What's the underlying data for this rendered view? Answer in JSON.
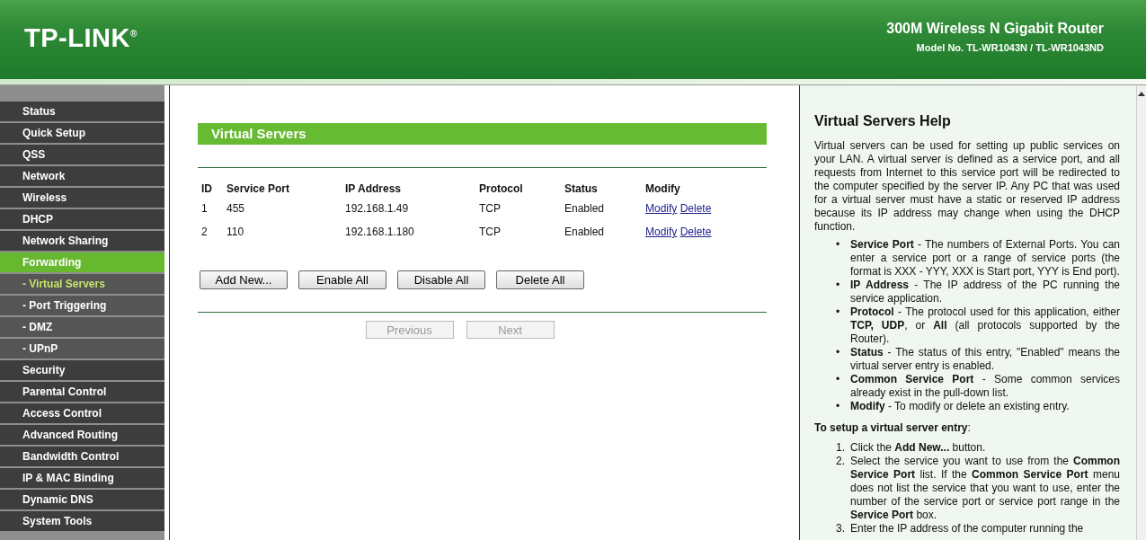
{
  "header": {
    "logo": "TP-LINK$^{®}$",
    "product": "300M Wireless N Gigabit Router",
    "model": "Model No. TL-WR1043N / TL-WR1043ND"
  },
  "sidebar": {
    "items": [
      {
        "label": "Status",
        "kind": "main",
        "selected": false
      },
      {
        "label": "Quick Setup",
        "kind": "main",
        "selected": false
      },
      {
        "label": "QSS",
        "kind": "main",
        "selected": false
      },
      {
        "label": "Network",
        "kind": "main",
        "selected": false
      },
      {
        "label": "Wireless",
        "kind": "main",
        "selected": false
      },
      {
        "label": "DHCP",
        "kind": "main",
        "selected": false
      },
      {
        "label": "Network Sharing",
        "kind": "main",
        "selected": false
      },
      {
        "label": "Forwarding",
        "kind": "main",
        "selected": true
      },
      {
        "label": "- Virtual Servers",
        "kind": "sub",
        "selected": true
      },
      {
        "label": "- Port Triggering",
        "kind": "sub",
        "selected": false
      },
      {
        "label": "- DMZ",
        "kind": "sub",
        "selected": false
      },
      {
        "label": "- UPnP",
        "kind": "sub",
        "selected": false
      },
      {
        "label": "Security",
        "kind": "main",
        "selected": false
      },
      {
        "label": "Parental Control",
        "kind": "main",
        "selected": false
      },
      {
        "label": "Access Control",
        "kind": "main",
        "selected": false
      },
      {
        "label": "Advanced Routing",
        "kind": "main",
        "selected": false
      },
      {
        "label": "Bandwidth Control",
        "kind": "main",
        "selected": false
      },
      {
        "label": "IP & MAC Binding",
        "kind": "main",
        "selected": false
      },
      {
        "label": "Dynamic DNS",
        "kind": "main",
        "selected": false
      },
      {
        "label": "System Tools",
        "kind": "main",
        "selected": false
      }
    ]
  },
  "main": {
    "title": "Virtual Servers",
    "table": {
      "columns": [
        "ID",
        "Service Port",
        "IP Address",
        "Protocol",
        "Status",
        "Modify"
      ],
      "rows": [
        {
          "id": "1",
          "service_port": "455",
          "ip_address": "192.168.1.49",
          "protocol": "TCP",
          "status": "Enabled",
          "modify": "Modify",
          "delete": "Delete"
        },
        {
          "id": "2",
          "service_port": "110",
          "ip_address": "192.168.1.180",
          "protocol": "TCP",
          "status": "Enabled",
          "modify": "Modify",
          "delete": "Delete"
        }
      ]
    },
    "buttons": [
      "Add New...",
      "Enable All",
      "Disable All",
      "Delete All"
    ],
    "pagination": [
      {
        "label": "Previous",
        "disabled": true
      },
      {
        "label": "Next",
        "disabled": true
      }
    ]
  },
  "help": {
    "title": "Virtual Servers Help",
    "intro": "Virtual servers can be used for setting up public services on your LAN. A virtual server is defined as a service port, and all requests from Internet to this service port will be redirected to the computer specified by the server IP. Any PC that was used for a virtual server must have a static or reserved IP address because its IP address may change when using the DHCP function.",
    "bullets": [
      {
        "marker": "•",
        "text": "**Service Port** - The numbers of External Ports. You can enter a service port or a range of service ports (the format is XXX - YYY, XXX is Start port, YYY is End port)."
      },
      {
        "marker": "•",
        "text": "**IP Address** - The IP address of the PC running the service application."
      },
      {
        "marker": "•",
        "text": "**Protocol** - The protocol used for this application, either **TCP, UDP**, or **All** (all protocols supported by the Router)."
      },
      {
        "marker": "•",
        "text": "**Status** - The status of this entry, \"Enabled\" means the virtual server entry is enabled."
      },
      {
        "marker": "•",
        "text": "**Common Service Port** - Some common services already exist in the pull-down list."
      },
      {
        "marker": "•",
        "text": "**Modify** - To modify or delete an existing entry."
      }
    ],
    "setup_title": "**To setup a virtual server entry**:",
    "steps": [
      {
        "number": "1.",
        "text": "Click the **Add New...** button."
      },
      {
        "number": "2.",
        "text": "Select the service you want to use from the **Common Service Port** list. If the **Common Service Port** menu does not list the service that you want to use, enter the number of the service port or service port range in the **Service Port** box."
      },
      {
        "number": "3.",
        "text": "Enter the IP address of the computer running the"
      }
    ]
  }
}
